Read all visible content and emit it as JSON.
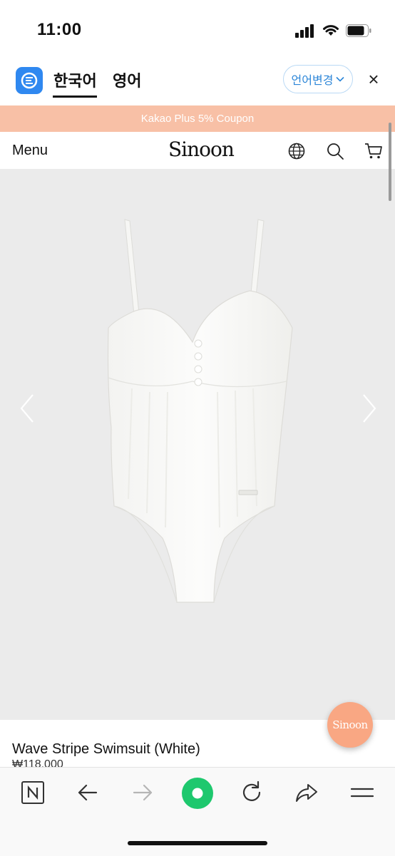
{
  "status_bar": {
    "time": "11:00"
  },
  "translate_bar": {
    "tab_korean": "한국어",
    "tab_english": "영어",
    "change_language": "언어변경",
    "close": "×"
  },
  "coupon_banner": "Kakao Plus 5% Coupon",
  "site_header": {
    "menu": "Menu",
    "logo": "Sinoon"
  },
  "product": {
    "name": "Wave Stripe Swimsuit (White)",
    "price": "₩118,000",
    "image_desc_icon": "swimsuit-image"
  },
  "fab": {
    "label": "Sinoon"
  },
  "colors": {
    "coupon_bg": "#f8c0a6",
    "accent_blue": "#2c86d8",
    "fab_bg": "#f9a783",
    "image_bg": "#ebebeb",
    "green_button": "#1ec86e"
  },
  "toolbar": {
    "icons": [
      "naver-n-icon",
      "back-arrow-icon",
      "forward-arrow-icon",
      "green-dot-icon",
      "reload-icon",
      "share-icon",
      "menu-lines-icon"
    ]
  }
}
